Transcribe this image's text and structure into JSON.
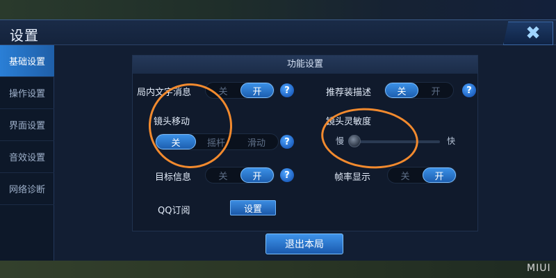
{
  "window": {
    "title": "设置",
    "close_glyph": "✖"
  },
  "sidebar": {
    "items": [
      {
        "label": "基础设置",
        "active": true
      },
      {
        "label": "操作设置",
        "active": false
      },
      {
        "label": "界面设置",
        "active": false
      },
      {
        "label": "音效设置",
        "active": false
      },
      {
        "label": "网络诊断",
        "active": false
      }
    ]
  },
  "panel": {
    "header": "功能设置",
    "in_game_text": {
      "label": "局内文字消息",
      "off": "关",
      "on": "开",
      "selected": "on"
    },
    "recommend_desc": {
      "label": "推荐装描述",
      "off": "关",
      "on": "开",
      "selected": "off"
    },
    "camera_move": {
      "label": "镜头移动",
      "options": [
        "关",
        "摇杆",
        "滑动"
      ],
      "selected": "关"
    },
    "camera_sensitivity": {
      "label": "镜头灵敏度",
      "min_label": "慢",
      "max_label": "快",
      "value_fraction": 0.0
    },
    "target_info": {
      "label": "目标信息",
      "off": "关",
      "on": "开",
      "selected": "on"
    },
    "fps_display": {
      "label": "帧率显示",
      "off": "关",
      "on": "开",
      "selected": "on"
    },
    "qq_subscribe": {
      "label": "QQ订阅",
      "button": "设置"
    },
    "help_glyph": "?"
  },
  "exit_button": "退出本局",
  "watermark": "MIUI",
  "colors": {
    "accent": "#2a7fd6",
    "annotation": "#f28a2e"
  }
}
